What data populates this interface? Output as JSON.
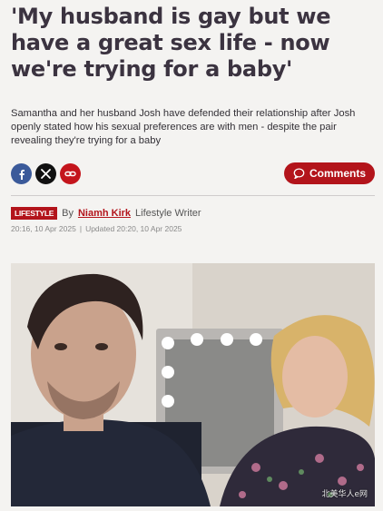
{
  "article": {
    "headline": "'My husband is gay but we have a great sex life - now we're trying for a baby'",
    "standfirst": "Samantha and her husband Josh have defended their relationship after Josh openly stated how his sexual preferences are with men - despite the pair revealing they're trying for a baby",
    "share": {
      "icons": [
        "facebook-icon",
        "x-icon",
        "link-icon"
      ]
    },
    "comments_label": "Comments",
    "byline": {
      "section_badge": "LIFESTYLE",
      "by": "By",
      "author": "Niamh Kirk",
      "role": "Lifestyle Writer"
    },
    "dates": {
      "published": "20:16, 10 Apr 2025",
      "separator": "|",
      "updated": "Updated 20:20, 10 Apr 2025"
    },
    "image_watermark": "北美华人e网"
  },
  "colors": {
    "accent": "#b3141b",
    "facebook": "#3b5a9a",
    "x": "#111111",
    "background": "#f4f3f1"
  }
}
